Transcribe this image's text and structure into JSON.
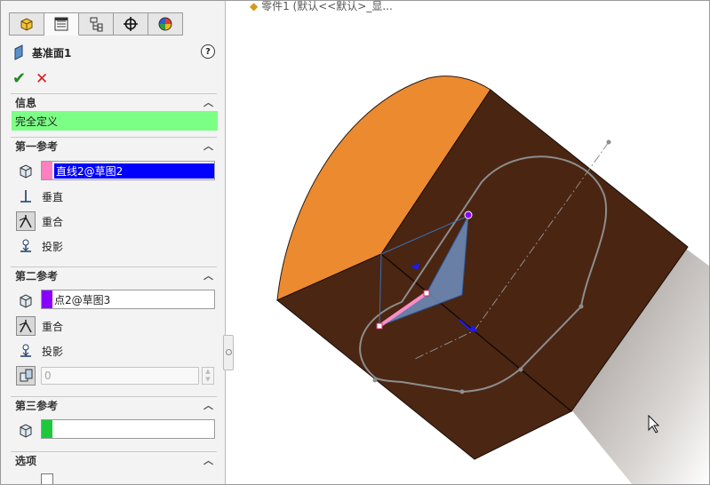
{
  "panel": {
    "tabs": [
      {
        "name": "feature-manager-tab",
        "icon": "feature-tree-icon"
      },
      {
        "name": "property-manager-tab",
        "icon": "property-list-icon"
      },
      {
        "name": "configuration-manager-tab",
        "icon": "configuration-icon"
      },
      {
        "name": "dimxpert-tab",
        "icon": "crosshair-icon"
      },
      {
        "name": "display-manager-tab",
        "icon": "color-wheel-icon"
      }
    ],
    "title": "基准面1",
    "help": "?",
    "ok_symbol": "✔",
    "cancel_symbol": "✕",
    "info": {
      "header": "信息",
      "status": "完全定义",
      "status_color": "#7bff84"
    },
    "first_ref": {
      "header": "第一参考",
      "selection": "直线2@草图2",
      "swatch_color": "#ff7fbf",
      "options": [
        "垂直",
        "重合",
        "投影"
      ]
    },
    "second_ref": {
      "header": "第二参考",
      "selection": "点2@草图3",
      "swatch_color": "#8a00ff",
      "options": [
        "重合",
        "投影"
      ],
      "distance_value": "0"
    },
    "third_ref": {
      "header": "第三参考",
      "selection": "",
      "swatch_color": "#1ec83c"
    },
    "options_section": {
      "header": "选项"
    }
  },
  "viewport": {
    "breadcrumb": "零件1 (默认<<默认>_显...",
    "colors": {
      "top_face": "#ec8a30",
      "side_face": "#4a2613",
      "plane_fill": "#6f8fbf",
      "sketch_line": "#7a7a7a"
    }
  }
}
